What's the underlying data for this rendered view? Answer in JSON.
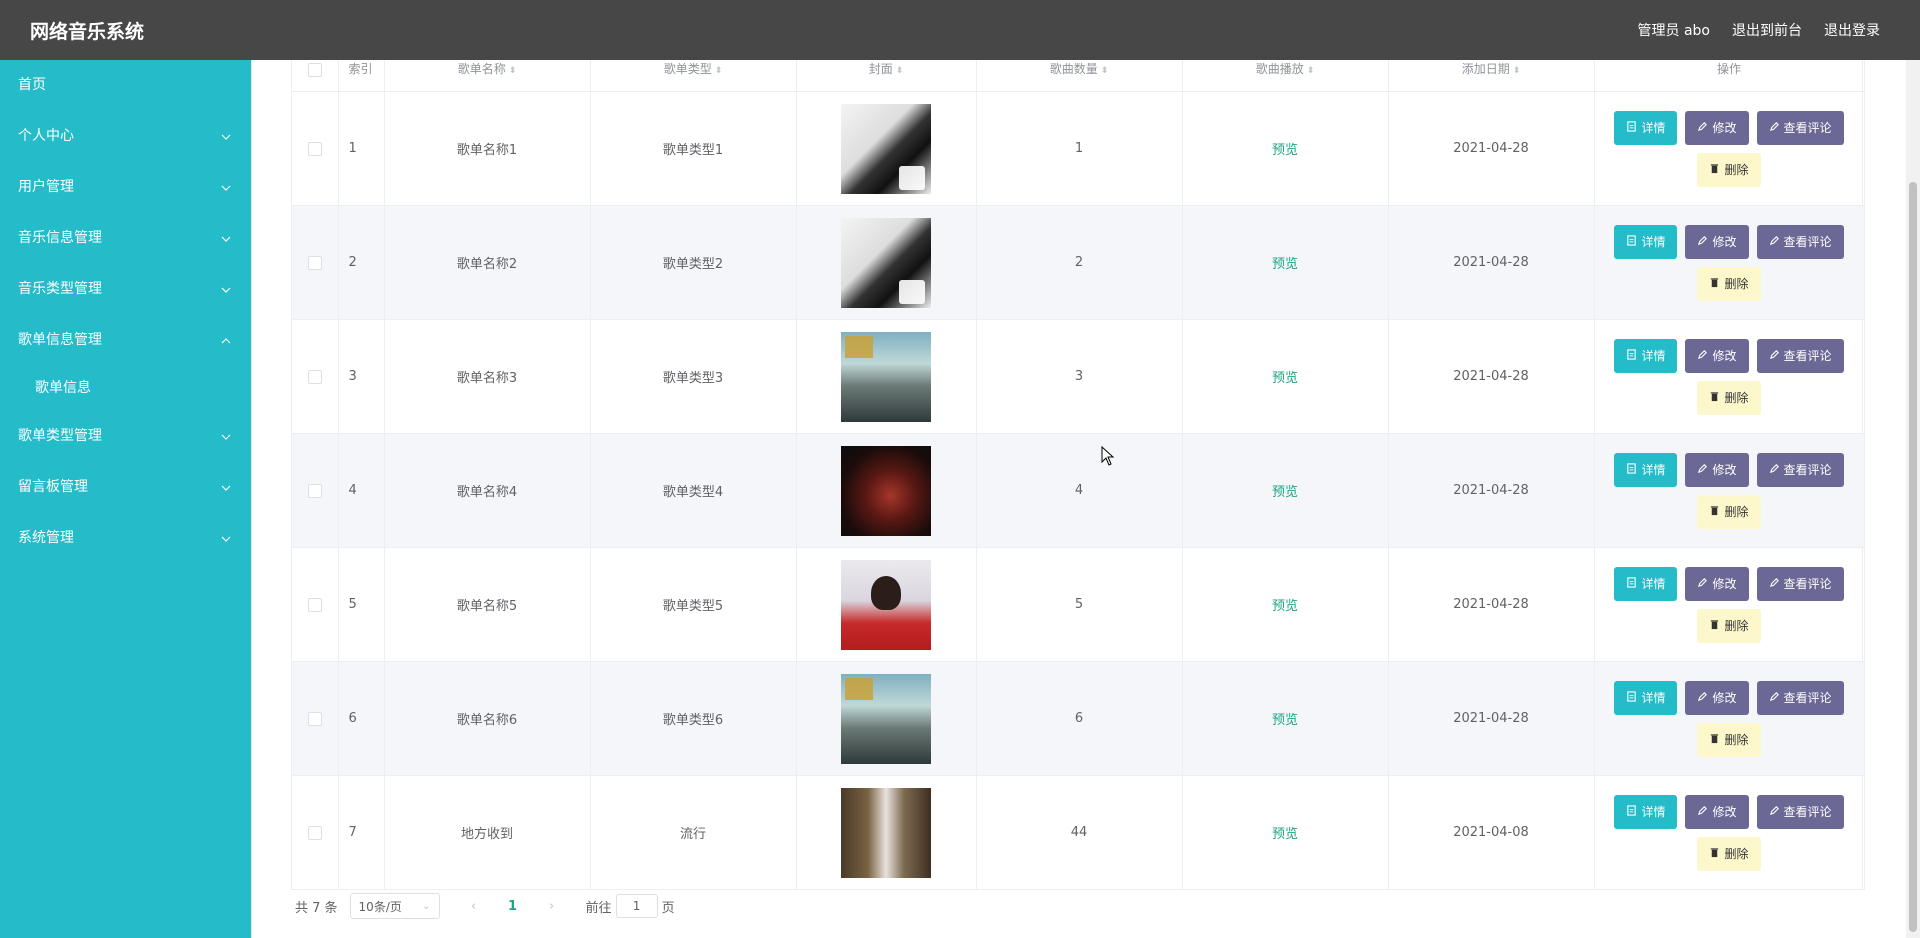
{
  "app": {
    "title": "网络音乐系统"
  },
  "header": {
    "user_label": "管理员 abo",
    "front_label": "退出到前台",
    "logout_label": "退出登录"
  },
  "sidebar": {
    "items": [
      {
        "label": "首页",
        "expandable": false
      },
      {
        "label": "个人中心",
        "expandable": true,
        "state": "collapsed"
      },
      {
        "label": "用户管理",
        "expandable": true,
        "state": "collapsed"
      },
      {
        "label": "音乐信息管理",
        "expandable": true,
        "state": "collapsed"
      },
      {
        "label": "音乐类型管理",
        "expandable": true,
        "state": "collapsed"
      },
      {
        "label": "歌单信息管理",
        "expandable": true,
        "state": "expanded"
      },
      {
        "label": "歌单信息",
        "expandable": false,
        "sub": true
      },
      {
        "label": "歌单类型管理",
        "expandable": true,
        "state": "collapsed"
      },
      {
        "label": "留言板管理",
        "expandable": true,
        "state": "collapsed"
      },
      {
        "label": "系统管理",
        "expandable": true,
        "state": "collapsed"
      }
    ]
  },
  "table": {
    "headers": {
      "index": "索引",
      "name": "歌单名称",
      "type": "歌单类型",
      "cover": "封面",
      "count": "歌曲数量",
      "play": "歌曲播放",
      "date": "添加日期",
      "ops": "操作"
    },
    "preview_label": "预览",
    "buttons": {
      "detail": "详情",
      "edit": "修改",
      "review": "查看评论",
      "delete": "删除"
    },
    "rows": [
      {
        "index": "1",
        "name": "歌单名称1",
        "type": "歌单类型1",
        "cover": "bw",
        "count": "1",
        "date": "2021-04-28"
      },
      {
        "index": "2",
        "name": "歌单名称2",
        "type": "歌单类型2",
        "cover": "bw",
        "count": "2",
        "date": "2021-04-28"
      },
      {
        "index": "3",
        "name": "歌单名称3",
        "type": "歌单类型3",
        "cover": "sky",
        "count": "3",
        "date": "2021-04-28"
      },
      {
        "index": "4",
        "name": "歌单名称4",
        "type": "歌单类型4",
        "cover": "dark",
        "count": "4",
        "date": "2021-04-28"
      },
      {
        "index": "5",
        "name": "歌单名称5",
        "type": "歌单类型5",
        "cover": "girl",
        "count": "5",
        "date": "2021-04-28"
      },
      {
        "index": "6",
        "name": "歌单名称6",
        "type": "歌单类型6",
        "cover": "sky",
        "count": "6",
        "date": "2021-04-28"
      },
      {
        "index": "7",
        "name": "地方收到",
        "type": "流行",
        "cover": "room",
        "count": "44",
        "date": "2021-04-08"
      }
    ]
  },
  "pagination": {
    "total": "共 7 条",
    "page_size": "10条/页",
    "current_page": "1",
    "goto_prefix": "前往",
    "goto_value": "1",
    "goto_suffix": "页"
  },
  "colors": {
    "header_bg": "#474747",
    "sidebar_bg": "#24bcc9",
    "detail_btn": "#24bcc9",
    "edit_btn": "#6b6895",
    "delete_btn": "#fdf8cc",
    "link": "#1fa383"
  }
}
